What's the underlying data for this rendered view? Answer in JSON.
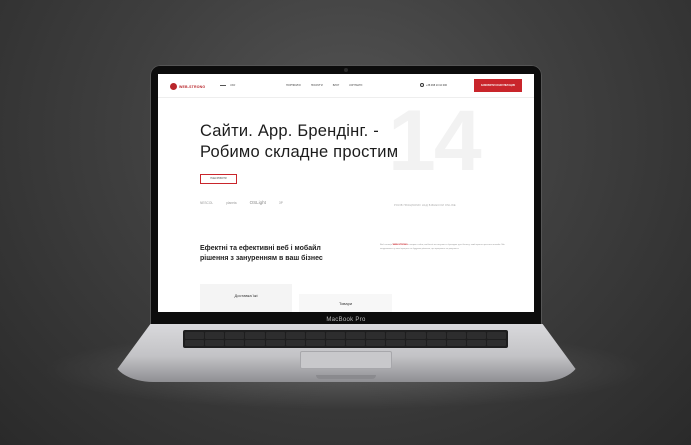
{
  "device": {
    "brand_label": "MacBook Pro"
  },
  "site": {
    "logo_text": "WEB-STRONG",
    "lang_label": "UKR",
    "nav": [
      "ПОРТФОЛІО",
      "ПОСЛУГИ",
      "БЛОГ",
      "КОНТАКТИ"
    ],
    "phone": "+38 068 10 10 006",
    "cta_label": "ЗАМОВИТИ КОНСУЛЬТАЦІЮ",
    "big_number": "14",
    "hero_title": "Сайти. App. Брендінг. - Робимо складне простим",
    "hero_button": "НАШІ РОБОТИ",
    "clients": [
      "NESCOL",
      "planeta",
      "OSLight",
      "ЗР"
    ],
    "tagline": "РОКІВ ПРАЦЮЄМО НАД БІЗНЕСОМ ONLINE",
    "section_title": "Ефектні та ефективні веб і мобайл рішення з зануренням в ваш бізнес",
    "section_text_prefix": "Веб-агенція",
    "section_text_brand": "WEB-STRONG",
    "section_text_rest": "створює сайти, мобільні застосунки та брендинг для бізнесу, який прагне зростати онлайн. Ми занурюємося у ваші процеси та будуємо рішення, що працюють на результат.",
    "cards": [
      "Доставка їжі",
      "Товари"
    ]
  },
  "colors": {
    "accent": "#c9252b",
    "background": "#3f3f3f",
    "screen_bg": "#ffffff"
  }
}
